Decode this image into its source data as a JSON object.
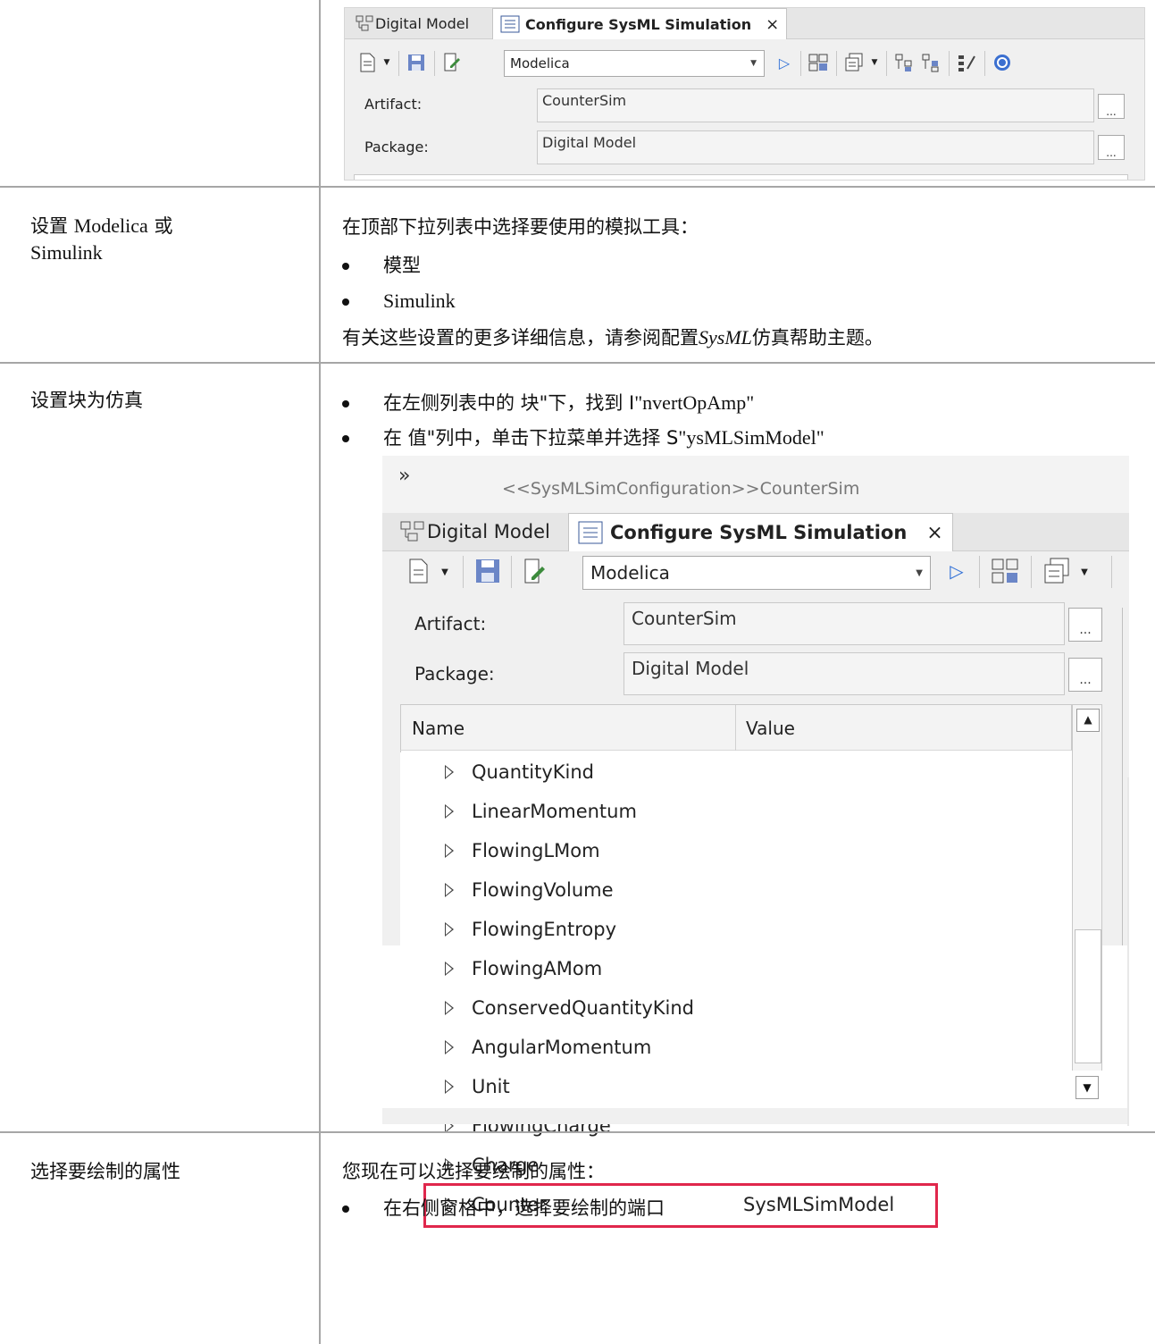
{
  "top_panel": {
    "tabs": [
      {
        "label": "Digital Model",
        "active": false
      },
      {
        "label": "Configure SysML Simulation",
        "active": true
      }
    ],
    "close_glyph": "×",
    "tool_dropdown_value": "Modelica",
    "artifact_label": "Artifact:",
    "artifact_value": "CounterSim",
    "package_label": "Package:",
    "package_value": "Digital Model",
    "browse_label": "..."
  },
  "row_simtool": {
    "left_prefix": "设置 ",
    "left_latin": "Modelica",
    "left_suffix": " 或",
    "left_line2": "Simulink",
    "intro": "在顶部下拉列表中选择要使用的模拟工具：",
    "options": [
      "模型",
      "Simulink"
    ],
    "note_prefix": "有关这些设置的更多详细信息，请参阅配置",
    "note_italic": "SysML",
    "note_suffix": "仿真帮助主题。"
  },
  "row_block": {
    "left": "设置块为仿真",
    "bullet1_prefix": "在左侧列表中的 块\"下，找到 I",
    "bullet1_latin": "\"nvertOpAmp\"",
    "bullet2_prefix": "在 值\"列中，单击下拉菜单并选择 S",
    "bullet2_latin": "\"ysMLSimModel\""
  },
  "big_panel": {
    "breadcrumb_glyph": "»",
    "breadcrumb": "<<SysMLSimConfiguration>>CounterSim",
    "tabs": [
      {
        "label": "Digital Model",
        "active": false
      },
      {
        "label": "Configure SysML Simulation",
        "active": true
      }
    ],
    "close_glyph": "×",
    "tool_dropdown_value": "Modelica",
    "artifact_label": "Artifact:",
    "artifact_value": "CounterSim",
    "package_label": "Package:",
    "package_value": "Digital Model",
    "browse_label": "...",
    "grid_headers": {
      "name": "Name",
      "value": "Value"
    },
    "rows": [
      {
        "name": "QuantityKind",
        "value": ""
      },
      {
        "name": "LinearMomentum",
        "value": ""
      },
      {
        "name": "FlowingLMom",
        "value": ""
      },
      {
        "name": "FlowingVolume",
        "value": ""
      },
      {
        "name": "FlowingEntropy",
        "value": ""
      },
      {
        "name": "FlowingAMom",
        "value": ""
      },
      {
        "name": "ConservedQuantityKind",
        "value": ""
      },
      {
        "name": "AngularMomentum",
        "value": ""
      },
      {
        "name": "Unit",
        "value": ""
      },
      {
        "name": "FlowingCharge",
        "value": ""
      },
      {
        "name": "Charge",
        "value": ""
      },
      {
        "name": "Counter",
        "value": "SysMLSimModel",
        "highlighted": true
      }
    ],
    "highlight_color": "#e0274c"
  },
  "row_props": {
    "left": "选择要绘制的属性",
    "intro": "您现在可以选择要绘制的属性：",
    "bullet1": "在右侧窗格中，选择要绘制的端口"
  }
}
